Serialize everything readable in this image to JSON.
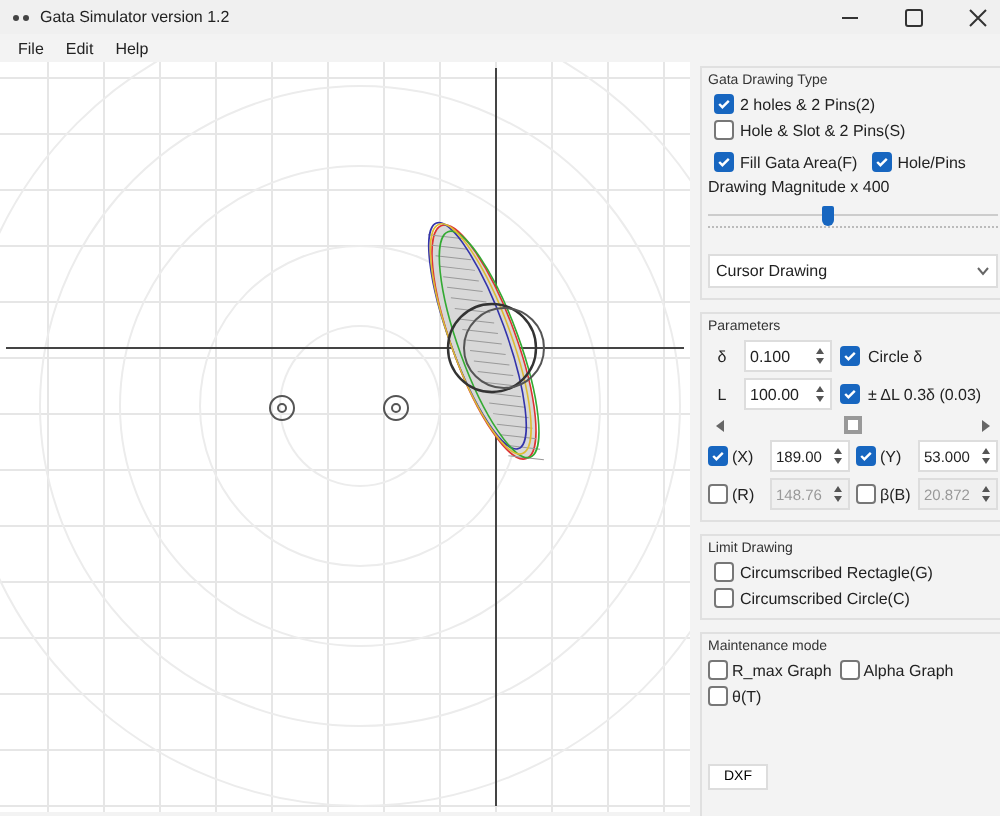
{
  "window": {
    "title": "Gata Simulator  version 1.2"
  },
  "menu": [
    "File",
    "Edit",
    "Help"
  ],
  "drawing_type": {
    "title": "Gata Drawing Type",
    "options": [
      {
        "label": "2 holes & 2 Pins(2)",
        "checked": true
      },
      {
        "label": "Hole & Slot & 2 Pins(S)",
        "checked": false
      }
    ],
    "toggles": [
      {
        "label": "Fill Gata Area(F)",
        "checked": true
      },
      {
        "label": "Hole/Pins",
        "checked": true
      }
    ],
    "magnitude": {
      "label": "Drawing Magnitude x 400",
      "level": 0.42
    },
    "mode": {
      "value": "Cursor Drawing"
    }
  },
  "parameters": {
    "title": "Parameters",
    "rows": [
      {
        "symbol": "δ",
        "value": "0.100",
        "option": {
          "label": "Circle δ",
          "checked": true
        }
      },
      {
        "symbol": "L",
        "value": "100.00",
        "option": {
          "label": "± ΔL 0.3δ (0.03)",
          "checked": true
        }
      }
    ],
    "coords": [
      {
        "label": "(X)",
        "checked": true,
        "value": "189.00",
        "disabled": false
      },
      {
        "label": "(Y)",
        "checked": true,
        "value": "53.000",
        "disabled": false
      },
      {
        "label": "(R)",
        "checked": false,
        "value": "148.76",
        "disabled": true
      },
      {
        "label": "β(B)",
        "checked": false,
        "value": "20.872",
        "disabled": true
      }
    ]
  },
  "limit": {
    "title": "Limit Drawing",
    "options": [
      {
        "label": "Circumscribed Rectagle(G)",
        "checked": false
      },
      {
        "label": "Circumscribed Circle(C)",
        "checked": false
      }
    ]
  },
  "maintenance": {
    "title": "Maintenance mode",
    "options": [
      {
        "label": "R_max Graph",
        "checked": false
      },
      {
        "label": "Alpha Graph",
        "checked": false
      },
      {
        "label": "θ(T)",
        "checked": false
      }
    ]
  },
  "dxf_button": "DXF"
}
